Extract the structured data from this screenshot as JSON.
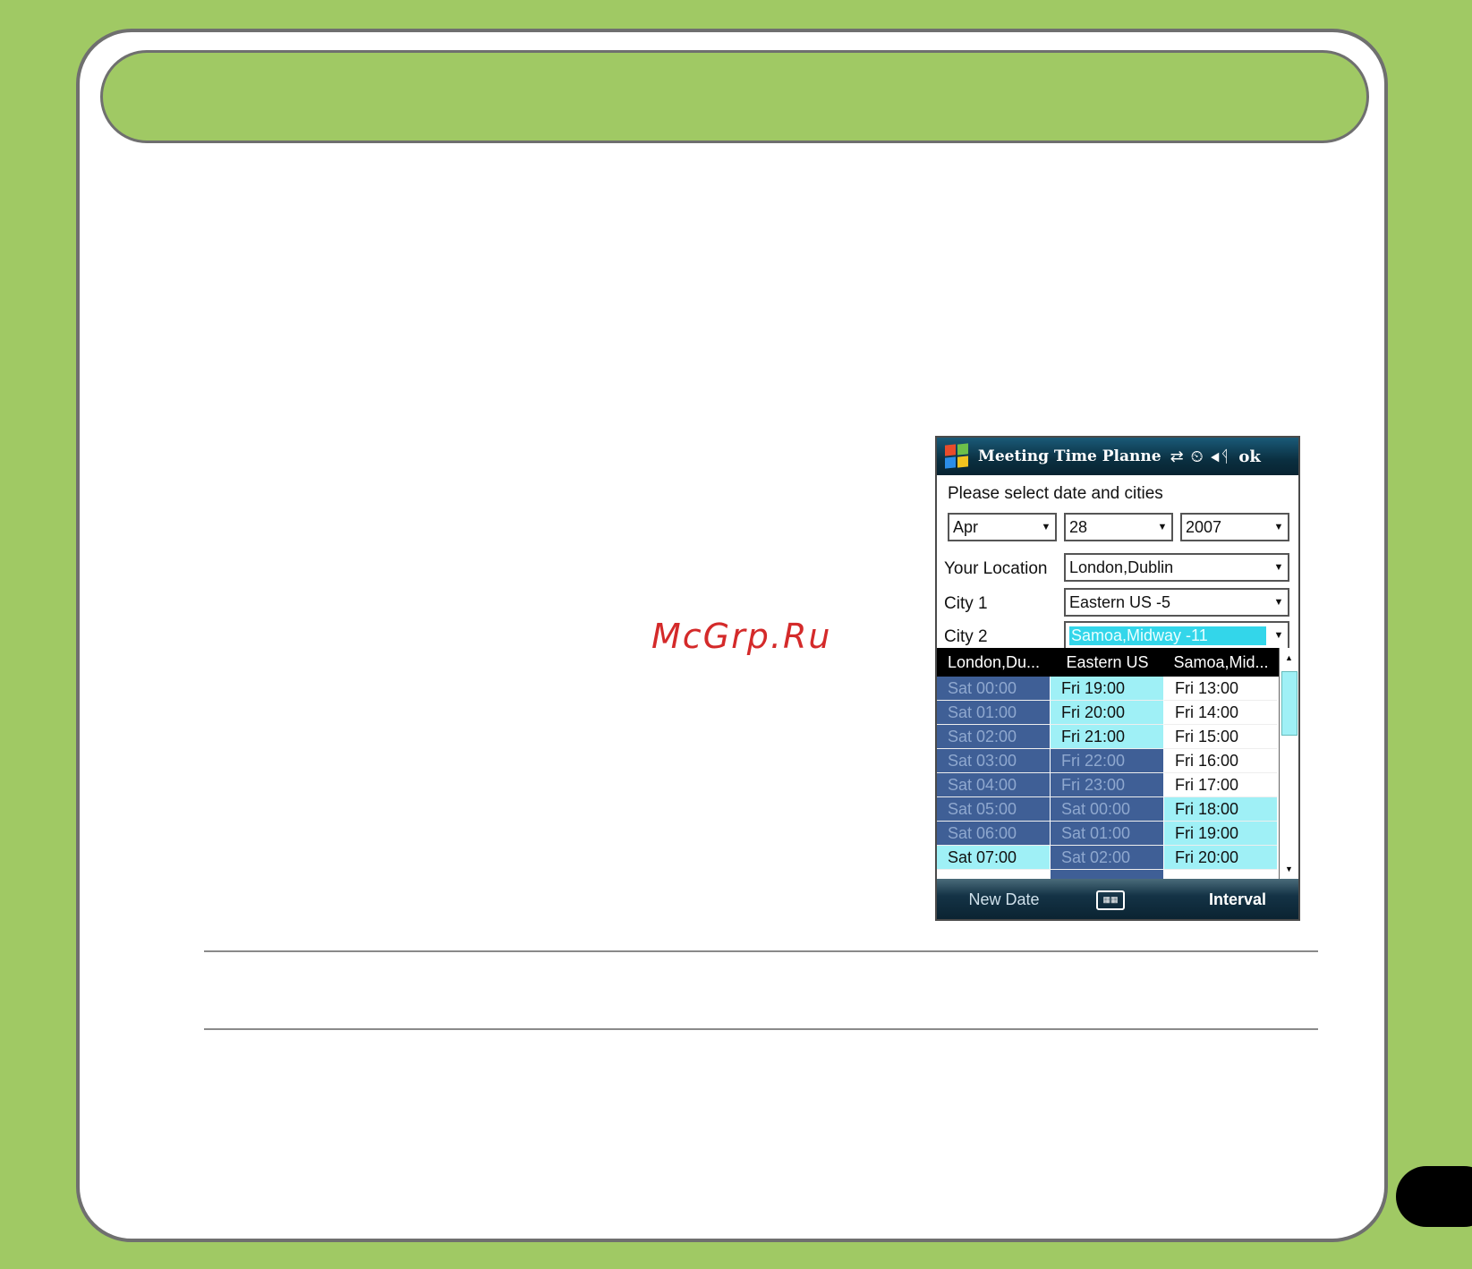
{
  "watermark": "McGrp.Ru",
  "app": {
    "title": "Meeting Time Planne",
    "ok_label": "ok",
    "prompt": "Please select date and cities",
    "date": {
      "month": "Apr",
      "day": "28",
      "year": "2007"
    },
    "your_location_label": "Your Location",
    "your_location_value": "London,Dublin",
    "city1_label": "City 1",
    "city1_value": "Eastern US -5",
    "city2_label": "City 2",
    "city2_value": "Samoa,Midway -11",
    "columns": [
      "London,Du...",
      "Eastern US",
      "Samoa,Mid..."
    ],
    "rows": [
      {
        "cells": [
          "Sat 00:00",
          "Fri 19:00",
          "Fri 13:00"
        ],
        "states": [
          "dark",
          "light",
          "white"
        ]
      },
      {
        "cells": [
          "Sat 01:00",
          "Fri 20:00",
          "Fri 14:00"
        ],
        "states": [
          "dark",
          "light",
          "white"
        ]
      },
      {
        "cells": [
          "Sat 02:00",
          "Fri 21:00",
          "Fri 15:00"
        ],
        "states": [
          "dark",
          "light",
          "white"
        ]
      },
      {
        "cells": [
          "Sat 03:00",
          "Fri 22:00",
          "Fri 16:00"
        ],
        "states": [
          "dark",
          "dark",
          "white"
        ]
      },
      {
        "cells": [
          "Sat 04:00",
          "Fri 23:00",
          "Fri 17:00"
        ],
        "states": [
          "dark",
          "dark",
          "white"
        ]
      },
      {
        "cells": [
          "Sat 05:00",
          "Sat 00:00",
          "Fri 18:00"
        ],
        "states": [
          "dark",
          "dark",
          "light"
        ]
      },
      {
        "cells": [
          "Sat 06:00",
          "Sat 01:00",
          "Fri 19:00"
        ],
        "states": [
          "dark",
          "dark",
          "light"
        ]
      },
      {
        "cells": [
          "Sat 07:00",
          "Sat 02:00",
          "Fri 20:00"
        ],
        "states": [
          "light",
          "dark",
          "light"
        ]
      },
      {
        "cells": [
          "",
          "",
          ""
        ],
        "states": [
          "white",
          "dark",
          "white"
        ]
      }
    ],
    "soft_left": "New Date",
    "soft_right": "Interval"
  },
  "colors": {
    "page_bg": "#a0c964",
    "selected_dark": "#3f5f96",
    "selected_light": "#9ff0f6",
    "title_bar": "#0a2f40"
  },
  "icons": [
    "windows-logo-icon",
    "connectivity-icon",
    "clock-alarm-icon",
    "speaker-icon",
    "keyboard-icon"
  ]
}
